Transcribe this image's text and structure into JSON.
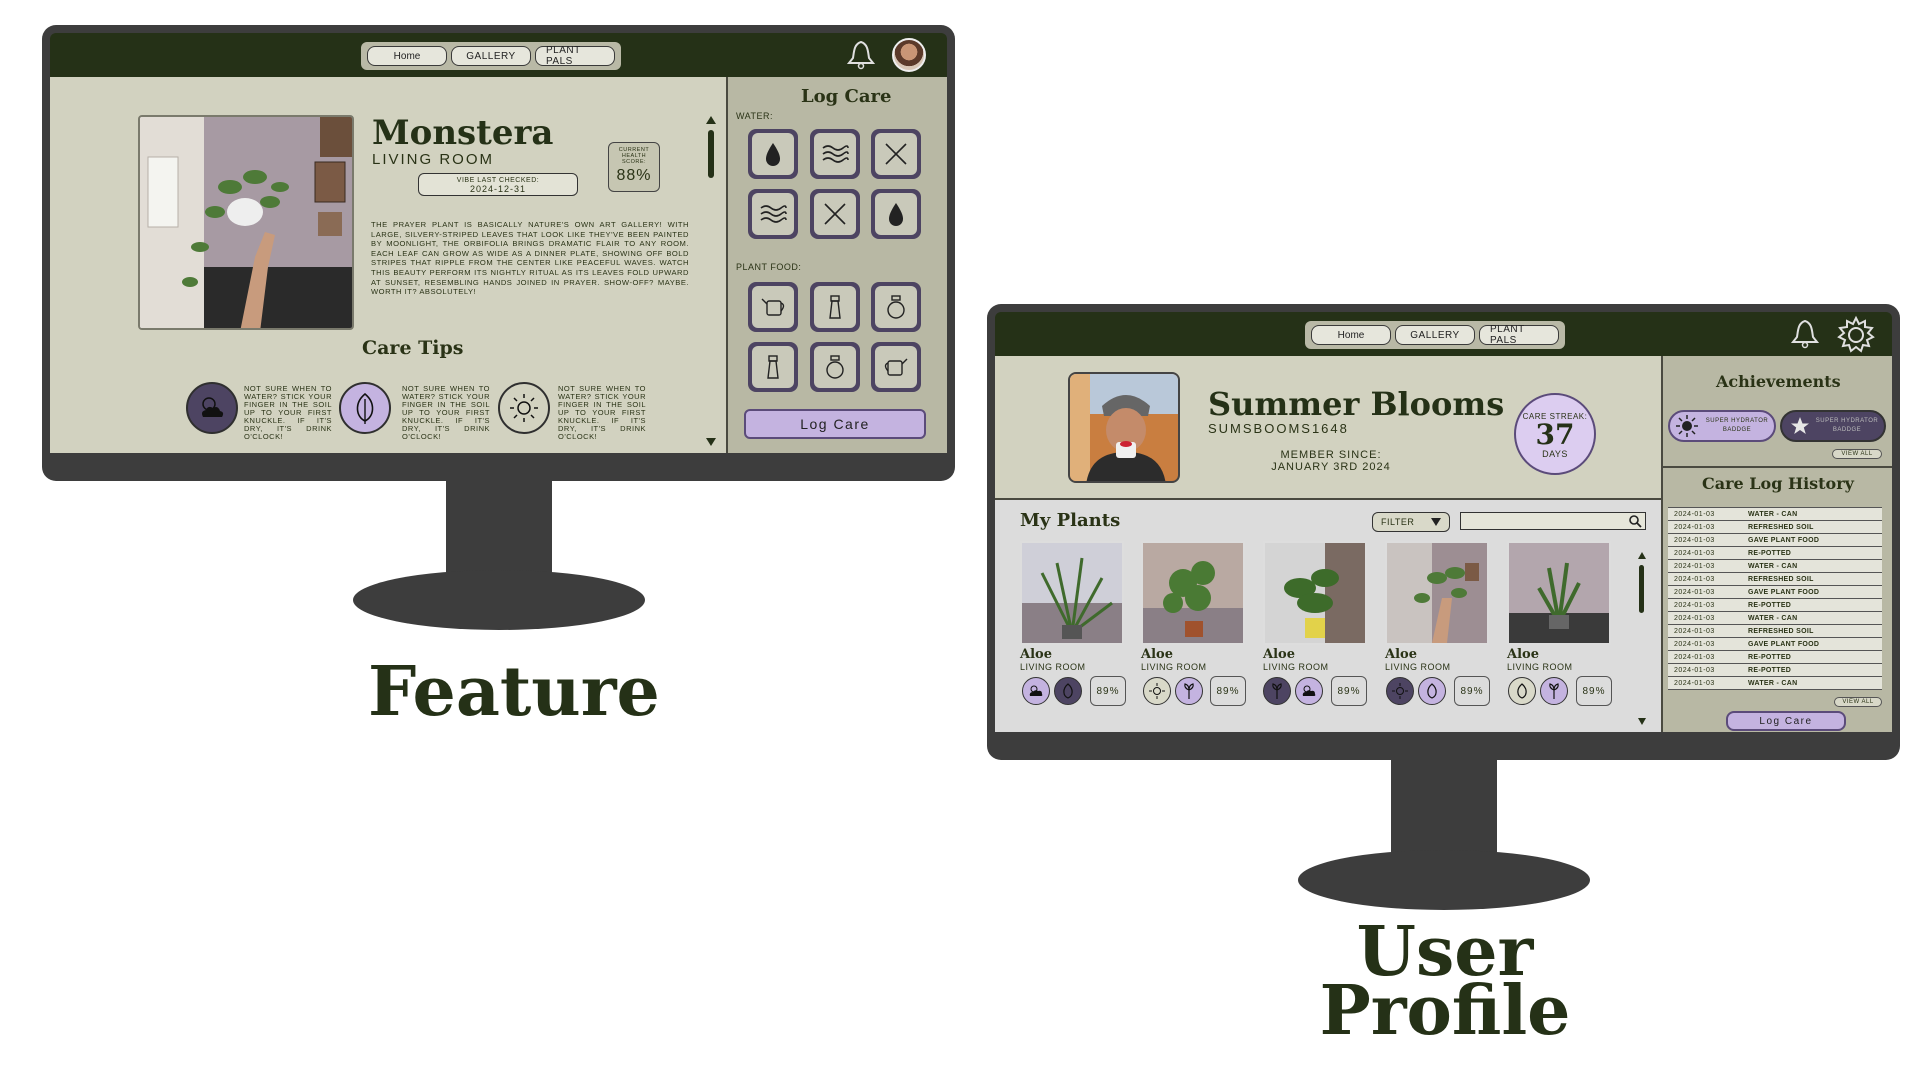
{
  "nav": {
    "home": "Home",
    "gallery": "Gallery",
    "plant_pals": "Plant Pals"
  },
  "feature": {
    "plant_name": "Monstera",
    "room": "Living Room",
    "vibe_label": "Vibe last checked:",
    "vibe_date": "2024-12-31",
    "health_label": "Current health score:",
    "health_value": "88%",
    "description": "The prayer plant is basically nature's own art gallery! With large, silvery-striped leaves that look like they've been painted by moonlight, the Orbifolia brings dramatic flair to any room. Each leaf can grow as wide as a dinner plate, showing off bold stripes that ripple from the center like peaceful waves. Watch this beauty perform its nightly ritual as its leaves fold upward at sunset, resembling hands joined in prayer. Show-off? Maybe. Worth it? Absolutely!",
    "care_tips_title": "Care Tips",
    "tips": [
      "Not sure when to water? Stick your finger in the soil up to your first knuckle. If it's dry, it's drink o'clock!",
      "Not sure when to water? Stick your finger in the soil up to your first knuckle. If it's dry, it's drink o'clock!",
      "Not sure when to water? Stick your finger in the soil up to your first knuckle. If it's dry, it's drink o'clock!"
    ],
    "log_care_title": "Log Care",
    "water_label": "Water:",
    "plant_food_label": "Plant Food:",
    "log_care_button": "Log Care",
    "caption": "Feature"
  },
  "profile": {
    "name": "Summer Blooms",
    "username": "sumsbooms1648",
    "member_label": "Member since:",
    "member_date": "January 3rd 2024",
    "streak_label": "Care streak:",
    "streak_value": "37",
    "streak_unit": "Days",
    "my_plants_title": "My Plants",
    "filter_label": "Filter",
    "plants": [
      {
        "name": "Aloe",
        "room": "Living Room",
        "score": "89%"
      },
      {
        "name": "Aloe",
        "room": "Living Room",
        "score": "89%"
      },
      {
        "name": "Aloe",
        "room": "Living Room",
        "score": "89%"
      },
      {
        "name": "Aloe",
        "room": "Living Room",
        "score": "89%"
      },
      {
        "name": "Aloe",
        "room": "Living Room",
        "score": "89%"
      }
    ],
    "achievements_title": "Achievements",
    "badges": [
      "Super Hydrator Baddge",
      "Super Hydrator Baddge"
    ],
    "view_all": "View All",
    "care_log_title": "Care Log History",
    "care_log": [
      {
        "date": "2024-01-03",
        "action": "Water - Can"
      },
      {
        "date": "2024-01-03",
        "action": "Refreshed Soil"
      },
      {
        "date": "2024-01-03",
        "action": "Gave Plant Food"
      },
      {
        "date": "2024-01-03",
        "action": "Re-Potted"
      },
      {
        "date": "2024-01-03",
        "action": "Water - Can"
      },
      {
        "date": "2024-01-03",
        "action": "Refreshed Soil"
      },
      {
        "date": "2024-01-03",
        "action": "Gave Plant Food"
      },
      {
        "date": "2024-01-03",
        "action": "Re-Potted"
      },
      {
        "date": "2024-01-03",
        "action": "Water - Can"
      },
      {
        "date": "2024-01-03",
        "action": "Refreshed Soil"
      },
      {
        "date": "2024-01-03",
        "action": "Gave Plant Food"
      },
      {
        "date": "2024-01-03",
        "action": "Re-Potted"
      },
      {
        "date": "2024-01-03",
        "action": "Re-Potted"
      },
      {
        "date": "2024-01-03",
        "action": "Water - Can"
      }
    ],
    "log_care_button": "Log Care",
    "caption_line1": "User",
    "caption_line2": "Profile"
  },
  "colors": {
    "dark_green": "#253117",
    "panel": "#d2d2c0",
    "sidebar": "#b8b8a4",
    "purple": "#4d4462",
    "lavender": "#c4b3e0"
  }
}
